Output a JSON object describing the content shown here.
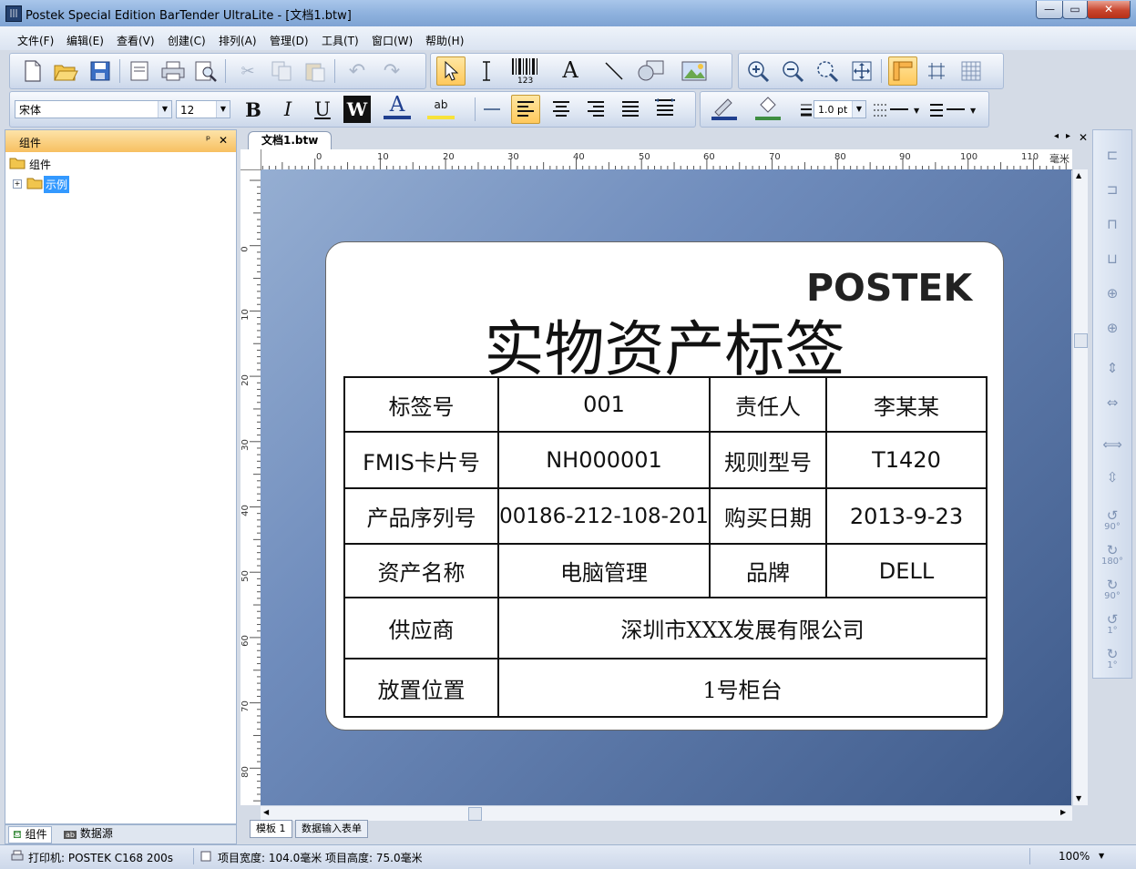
{
  "window": {
    "title": "Postek Special Edition BarTender UltraLite - [文档1.btw]",
    "app_icon": "bartender-icon",
    "minimize": "—",
    "maximize": "▭",
    "close": "✕"
  },
  "menu": [
    "文件(F)",
    "编辑(E)",
    "查看(V)",
    "创建(C)",
    "排列(A)",
    "管理(D)",
    "工具(T)",
    "窗口(W)",
    "帮助(H)"
  ],
  "toolbar": {
    "barcode_caption": "123",
    "text_tool": "A",
    "font_name": "宋体",
    "font_size": "12",
    "bold": "B",
    "italic": "I",
    "underline": "U",
    "reverse": "W",
    "font_color": "A",
    "highlight": "ab",
    "line_weight": "1.0 pt"
  },
  "left_panel": {
    "title": "组件",
    "pin": "ᵖ",
    "close": "✕",
    "tree_root": "组件",
    "tree_child": "示例",
    "tab_components": "组件",
    "tab_datasource": "数据源"
  },
  "document": {
    "tab": "文档1.btw",
    "ruler_unit": "毫米",
    "h_ticks": [
      "0",
      "10",
      "20",
      "30",
      "40",
      "50",
      "60",
      "70",
      "80",
      "90",
      "100",
      "110"
    ],
    "v_ticks": [
      "0",
      "10",
      "20",
      "30",
      "40",
      "50",
      "60",
      "70",
      "80"
    ],
    "bottom_tabs": [
      "模板 1",
      "数据输入表单"
    ]
  },
  "label": {
    "logo": "POSTEK",
    "title": "实物资产标签",
    "rows": [
      [
        "标签号",
        "001",
        "责任人",
        "李某某"
      ],
      [
        "FMIS卡片号",
        "NH000001",
        "规则型号",
        "T1420"
      ],
      [
        "产品序列号",
        "00186-212-108-201",
        "购买日期",
        "2013-9-23"
      ],
      [
        "资产名称",
        "电脑管理",
        "品牌",
        "DELL"
      ],
      [
        "供应商",
        "深圳市XXX发展有限公司"
      ],
      [
        "放置位置",
        "1号柜台"
      ]
    ]
  },
  "right_toolbar": {
    "rot_90": "90°",
    "rot_180": "180°",
    "rot_90b": "90°",
    "rot_1": "1°",
    "rot_1b": "1°"
  },
  "status": {
    "printer": "打印机: POSTEK C168 200s",
    "item_width": "项目宽度: 104.0毫米",
    "item_height": "项目高度: 75.0毫米",
    "zoom": "100%"
  },
  "colors": {
    "title_bar": "#8fb2de",
    "canvas_bg": "#5a76a6",
    "panel_header": "#f7c061",
    "selected_tool": "#ffc95c"
  }
}
